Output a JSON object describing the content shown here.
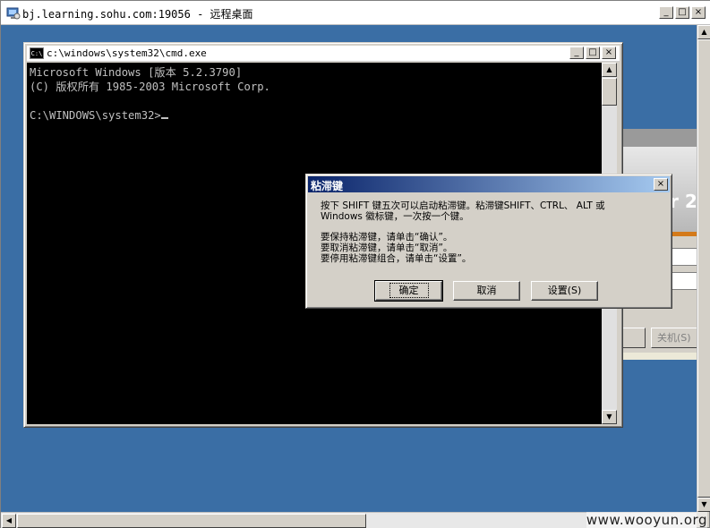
{
  "outer_window": {
    "title": "bj.learning.sohu.com:19056 - 远程桌面",
    "controls": {
      "minimize": "_",
      "maximize": "□",
      "close": "×"
    }
  },
  "cmd_window": {
    "title": "c:\\windows\\system32\\cmd.exe",
    "icon_label": "C:\\",
    "lines": [
      "Microsoft Windows [版本 5.2.3790]",
      "(C) 版权所有 1985-2003 Microsoft Corp.",
      "",
      "C:\\WINDOWS\\system32>"
    ],
    "controls": {
      "minimize": "_",
      "maximize": "□",
      "close": "×"
    }
  },
  "dialog": {
    "title": "粘滞键",
    "close": "×",
    "line1": "按下 SHIFT 键五次可以启动粘滞键。粘滞键SHIFT、CTRL、 ALT 或",
    "line2": "Windows 徽标键，一次按一个键。",
    "line3": "要保持粘滞键，请单击“确认”。",
    "line4": "要取消粘滞键，请单击“取消”。",
    "line5": "要停用粘滞键组合，请单击“设置”。",
    "buttons": {
      "ok": "确定",
      "cancel": "取消",
      "settings": "设置(S)"
    }
  },
  "background_window": {
    "logo_fragment": "r 2",
    "shutdown_label": "关机(S)"
  },
  "scroll": {
    "up": "▲",
    "down": "▼",
    "left": "◀",
    "right": "▶"
  },
  "watermark": "www.wooyun.org",
  "colors": {
    "desktop": "#3a6ea5",
    "dialog_title": "#0a246a",
    "console_bg": "#000000",
    "console_fg": "#c0c0c0"
  }
}
